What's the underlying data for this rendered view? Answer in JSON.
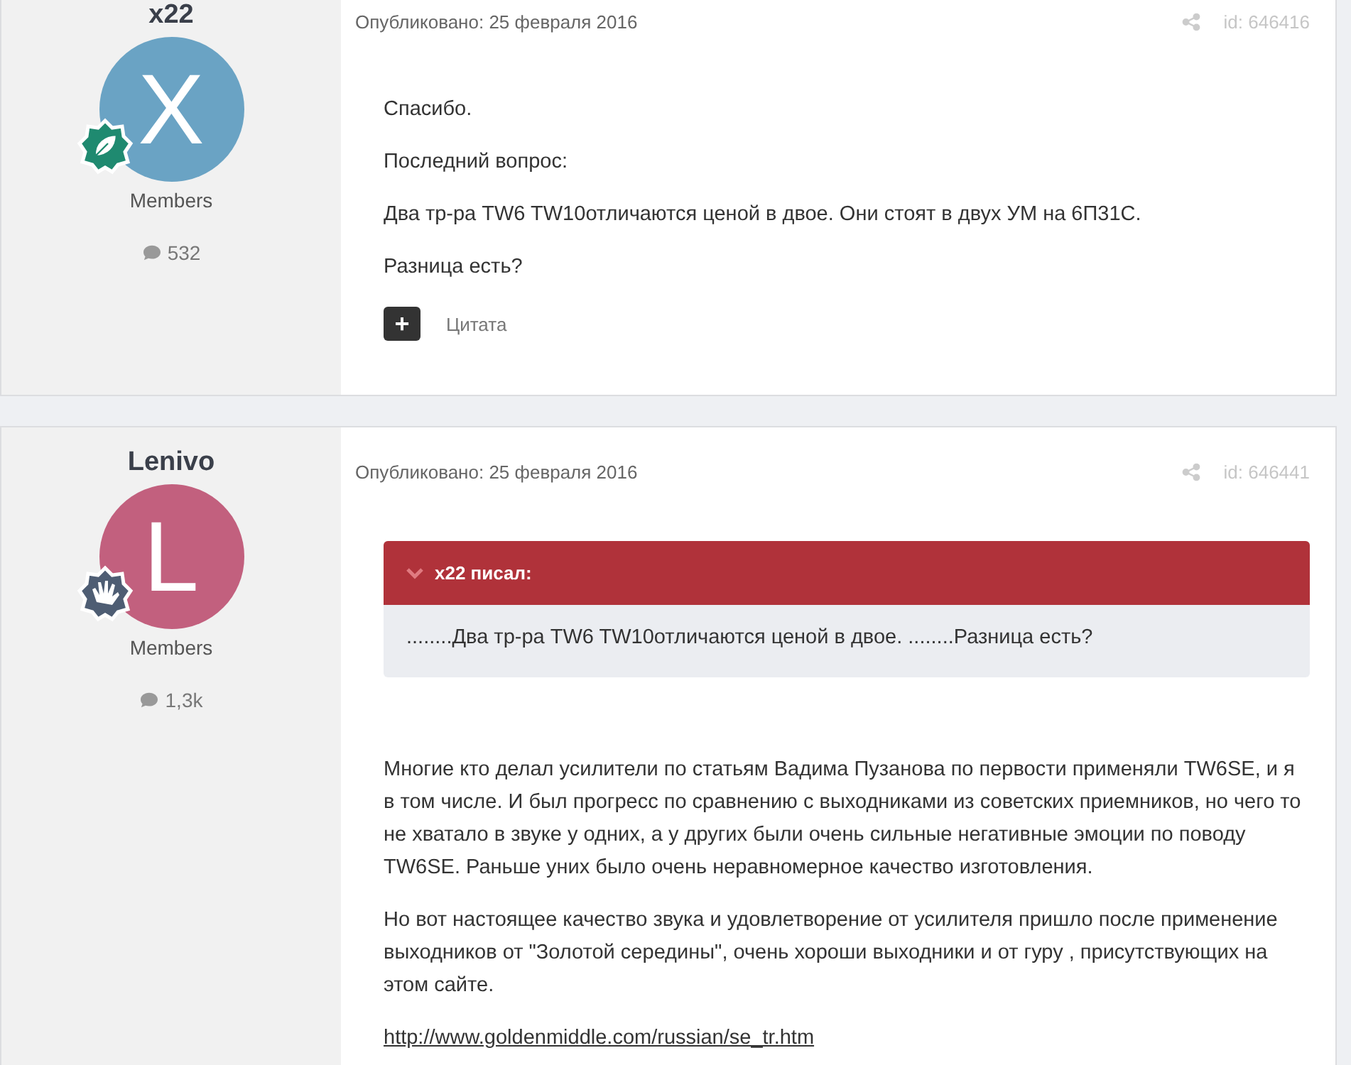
{
  "posts": [
    {
      "author": "x22",
      "avatar_letter": "X",
      "color": "#6aa3c4",
      "badge": {
        "kind": "leaf"
      },
      "group": "Members",
      "post_count": "532",
      "date": "Опубликовано: 25 февраля 2016",
      "post_id": "id: 646416",
      "blocks": [
        {
          "kind": "text",
          "text": "Спасибо."
        },
        {
          "kind": "text",
          "text": "Последний вопрос:"
        },
        {
          "kind": "text",
          "text": "Два тр-ра TW6 TW10отличаются ценой в двое. Они стоят в двух УМ на 6П31С."
        },
        {
          "kind": "text",
          "text": "Разница есть?"
        }
      ],
      "quote_button": {
        "icon": "+",
        "label": "Цитата"
      }
    },
    {
      "author": "Lenivo",
      "avatar_letter": "L",
      "color": "#c2607e",
      "badge": {
        "kind": "hand"
      },
      "group": "Members",
      "post_count": "1,3k",
      "date": "Опубликовано: 25 февраля 2016",
      "post_id": "id: 646441",
      "blocks": [
        {
          "kind": "quote",
          "citation": "x22 писал:",
          "text": "........Два тр-ра TW6 TW10отличаются ценой в двое. ........Разница есть?"
        },
        {
          "kind": "text",
          "text": "Многие кто делал усилители по статьям Вадима Пузанова по первости применяли TW6SE, и я в том числе. И был прогресс по сравнению с выходниками из советских приемников, но чего то не хватало в звуке у одних, а у других были очень сильные негативные эмоции по поводу TW6SE. Раньше уних было очень неравномерное качество изготовления."
        },
        {
          "kind": "text",
          "text": "Но вот настоящее качество звука и удовлетворение от усилителя пришло после применение выходников от \"Золотой середины\", очень хороши выходники и от гуру , присутствующих на этом сайте."
        },
        {
          "kind": "link",
          "text": "http://www.goldenmiddle.com/russian/se_tr.htm"
        }
      ]
    }
  ]
}
